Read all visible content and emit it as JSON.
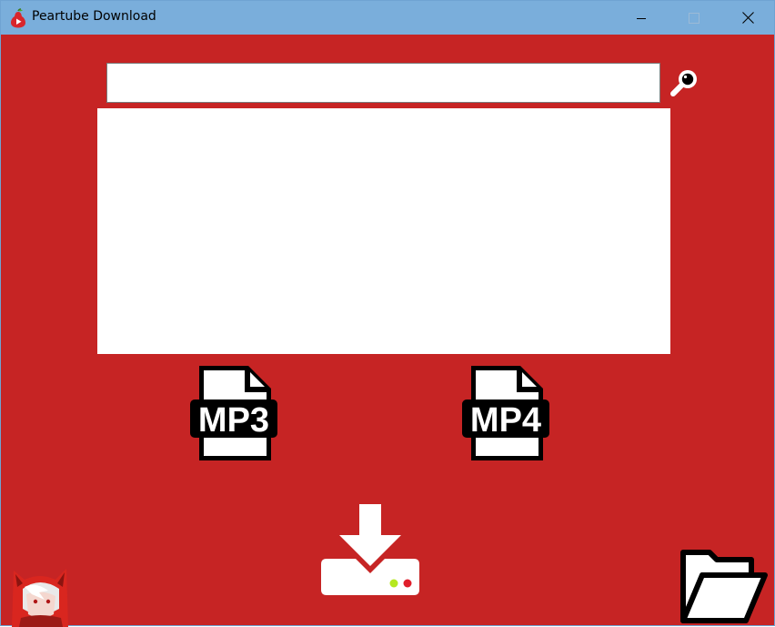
{
  "window": {
    "title": "Peartube Download",
    "controls": {
      "minimize": "minimize-icon",
      "maximize": "maximize-icon",
      "close": "close-icon"
    }
  },
  "search": {
    "value": "",
    "placeholder": ""
  },
  "results": {
    "items": []
  },
  "formats": {
    "mp3_label": "MP3",
    "mp4_label": "MP4"
  },
  "icons": {
    "search": "search-icon",
    "download": "download-icon",
    "folder": "folder-open-icon",
    "avatar": "avatar"
  },
  "colors": {
    "background": "#c62424",
    "titlebar": "#7aaedb",
    "foreground": "#ffffff",
    "led_green": "#b5e81f",
    "led_red": "#e01e2b"
  }
}
